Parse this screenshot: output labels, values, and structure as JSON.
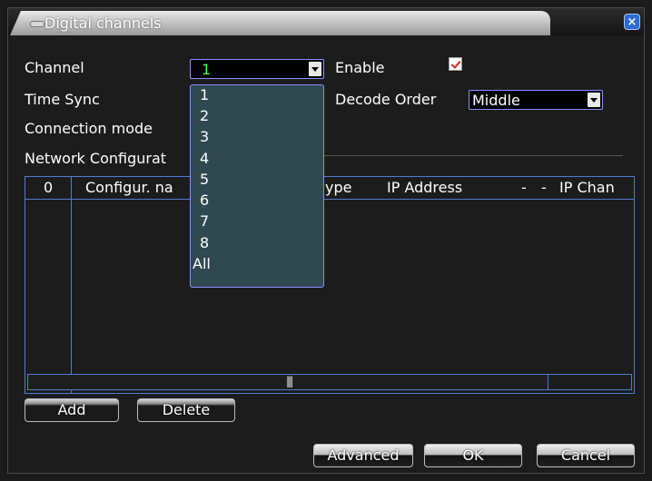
{
  "window": {
    "title": "Digital channels",
    "close_label": "×"
  },
  "form": {
    "channel_label": "Channel",
    "channel_value": "1",
    "enable_label": "Enable",
    "enable_checked": true,
    "time_sync_label": "Time Sync",
    "decode_order_label": "Decode Order",
    "decode_order_value": "Middle",
    "connection_mode_label": "Connection mode",
    "network_config_label": "Network Configurat"
  },
  "dropdown": {
    "options": [
      "1",
      "2",
      "3",
      "4",
      "5",
      "6",
      "7",
      "8",
      "All"
    ]
  },
  "table": {
    "headers": [
      "0",
      "Configur. na",
      "ype",
      "IP Address",
      "-",
      "-",
      "IP Chan"
    ],
    "rows": []
  },
  "scrollbar": {
    "grip": "|||"
  },
  "buttons": {
    "add": "Add",
    "delete": "Delete",
    "advanced": "Advanced",
    "ok": "OK",
    "cancel": "Cancel"
  },
  "colors": {
    "accent_border": "#8c8cff",
    "table_border": "#4f7bd0",
    "dropdown_bg": "#304850",
    "selected_text": "#4cff4c",
    "check_mark": "#e02020"
  }
}
